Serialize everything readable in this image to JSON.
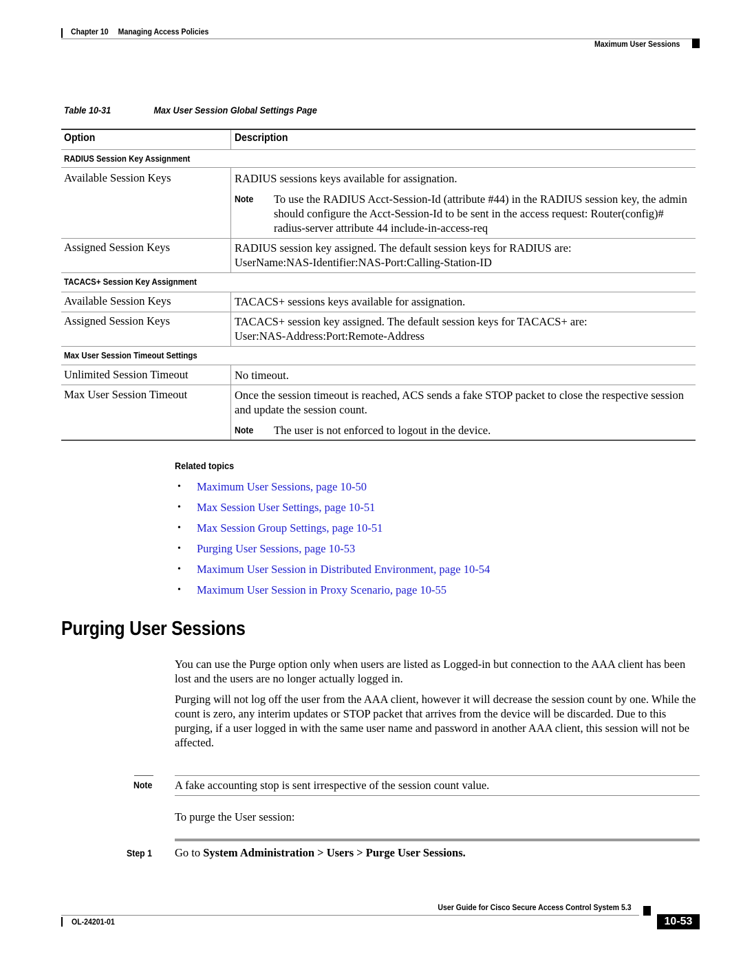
{
  "header": {
    "chapter_label": "Chapter 10",
    "chapter_title": "Managing Access Policies",
    "section": "Maximum User Sessions"
  },
  "table": {
    "caption_number": "Table 10-31",
    "caption_title": "Max User Session Global Settings Page",
    "columns": [
      "Option",
      "Description"
    ],
    "note_label": "Note",
    "groups": [
      {
        "title": "RADIUS Session Key Assignment",
        "rows": [
          {
            "option": "Available Session Keys",
            "description": "RADIUS sessions keys available for assignation.",
            "note": "To use the RADIUS Acct-Session-Id (attribute #44) in the RADIUS session key, the admin should configure the Acct-Session-Id to be sent in the access request: Router(config)# radius-server attribute 44 include-in-access-req"
          },
          {
            "option": "Assigned Session Keys",
            "description": "RADIUS session key assigned. The default session keys for RADIUS are: UserName:NAS-Identifier:NAS-Port:Calling-Station-ID"
          }
        ]
      },
      {
        "title": "TACACS+ Session Key Assignment",
        "rows": [
          {
            "option": "Available Session Keys",
            "description": "TACACS+ sessions keys available for assignation."
          },
          {
            "option": "Assigned Session Keys",
            "description": "TACACS+ session key assigned. The default session keys for TACACS+ are: User:NAS-Address:Port:Remote-Address"
          }
        ]
      },
      {
        "title": "Max User Session Timeout Settings",
        "rows": [
          {
            "option": "Unlimited Session Timeout",
            "description": "No timeout."
          },
          {
            "option": "Max User Session Timeout",
            "description": "Once the session timeout is reached, ACS sends a fake STOP packet to close the respective session and update the session count.",
            "note": "The user is not enforced to logout in the device."
          }
        ]
      }
    ]
  },
  "related": {
    "title": "Related topics",
    "links": [
      "Maximum User Sessions, page 10-50",
      "Max Session User Settings, page 10-51",
      "Max Session Group Settings, page 10-51",
      "Purging User Sessions, page 10-53",
      "Maximum User Session in Distributed Environment, page 10-54",
      "Maximum User Session in Proxy Scenario, page 10-55"
    ]
  },
  "section": {
    "heading": "Purging User Sessions",
    "paragraphs": [
      "You can use the Purge option only when users are listed as Logged-in but connection to the AAA client has been lost and the users are no longer actually logged in.",
      "Purging will not log off the user from the AAA client, however it will decrease the session count by one. While the count is zero, any interim updates or STOP packet that arrives from the device will be discarded. Due to this purging, if a user logged in with the same user name and password in another AAA client, this session will not be affected."
    ],
    "note_label": "Note",
    "note_text": "A fake accounting stop is sent irrespective of the session count value.",
    "intro": "To purge the User session:",
    "step_label": "Step 1",
    "step_prefix": "Go to ",
    "step_path": "System Administration > Users > Purge User Sessions."
  },
  "footer": {
    "guide_title": "User Guide for Cisco Secure Access Control System 5.3",
    "doc_number": "OL-24201-01",
    "page_number": "10-53"
  }
}
